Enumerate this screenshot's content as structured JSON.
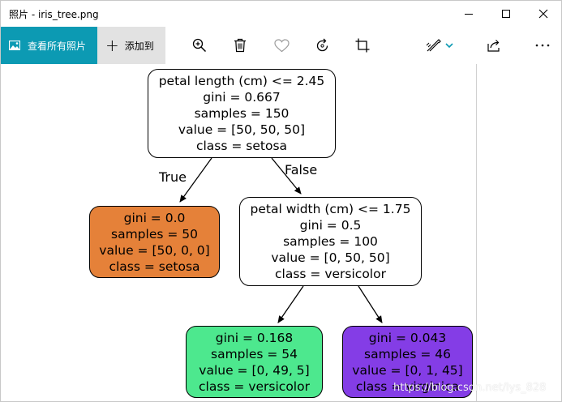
{
  "window": {
    "title": "照片 - iris_tree.png"
  },
  "toolbar": {
    "see_all_label": "查看所有照片",
    "add_to_label": "添加到",
    "icons": [
      "zoom-in-icon",
      "delete-icon",
      "heart-icon",
      "rotate-icon",
      "crop-icon",
      "edit-icon",
      "share-icon",
      "more-icon"
    ],
    "accent_color": "#0c9ab3"
  },
  "tree": {
    "root": {
      "lines": [
        "petal length (cm) <= 2.45",
        "gini = 0.667",
        "samples = 150",
        "value = [50, 50, 50]",
        "class = setosa"
      ],
      "color": "#ffffff"
    },
    "true_label": "True",
    "false_label": "False",
    "left_leaf": {
      "lines": [
        "gini = 0.0",
        "samples = 50",
        "value = [50, 0, 0]",
        "class = setosa"
      ],
      "color": "#e58139"
    },
    "mid": {
      "lines": [
        "petal width (cm) <= 1.75",
        "gini = 0.5",
        "samples = 100",
        "value = [0, 50, 50]",
        "class = versicolor"
      ],
      "color": "#ffffff"
    },
    "leaf_versicolor": {
      "lines": [
        "gini = 0.168",
        "samples = 54",
        "value = [0, 49, 5]",
        "class = versicolor"
      ],
      "color": "#4de88e"
    },
    "leaf_virginica": {
      "lines": [
        "gini = 0.043",
        "samples = 46",
        "value = [0, 1, 45]",
        "class = virginica"
      ],
      "color": "#843de6"
    }
  },
  "watermark": "https://blog.csdn.net/lys_828"
}
